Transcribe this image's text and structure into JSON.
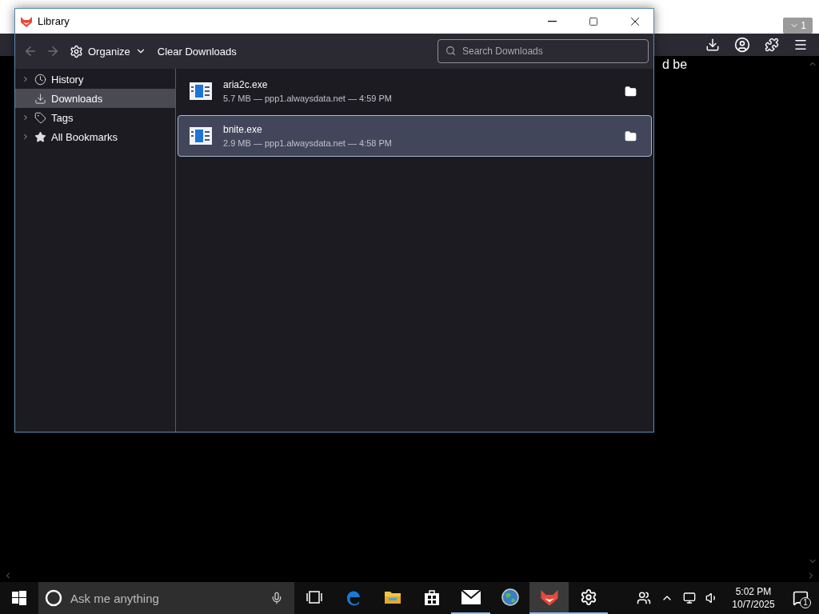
{
  "background_browser": {
    "page_text": "d be",
    "tab_count": "1"
  },
  "library": {
    "title": "Library",
    "toolbar": {
      "organize": "Organize",
      "clear": "Clear Downloads",
      "search_placeholder": "Search Downloads"
    },
    "sidebar": [
      {
        "kind": "history",
        "label": "History",
        "expandable": true,
        "selected": false
      },
      {
        "kind": "downloads",
        "label": "Downloads",
        "expandable": false,
        "selected": true
      },
      {
        "kind": "tags",
        "label": "Tags",
        "expandable": true,
        "selected": false
      },
      {
        "kind": "bookmarks",
        "label": "All Bookmarks",
        "expandable": true,
        "selected": false
      }
    ],
    "downloads": [
      {
        "name": "aria2c.exe",
        "details": "5.7 MB — ppp1.alwaysdata.net — 4:59 PM",
        "selected": false
      },
      {
        "name": "bnite.exe",
        "details": "2.9 MB — ppp1.alwaysdata.net — 4:58 PM",
        "selected": true
      }
    ]
  },
  "taskbar": {
    "search_placeholder": "Ask me anything",
    "time": "5:02 PM",
    "date": "10/7/2025",
    "notifications": "1",
    "apps": [
      {
        "kind": "taskview",
        "running": false,
        "selected": false
      },
      {
        "kind": "edge",
        "running": false,
        "selected": false
      },
      {
        "kind": "explorer",
        "running": false,
        "selected": false
      },
      {
        "kind": "store",
        "running": false,
        "selected": false
      },
      {
        "kind": "mail",
        "running": true,
        "selected": false
      },
      {
        "kind": "globe",
        "running": false,
        "selected": false
      },
      {
        "kind": "fox",
        "running": true,
        "selected": true
      },
      {
        "kind": "settings",
        "running": true,
        "selected": false
      }
    ]
  }
}
